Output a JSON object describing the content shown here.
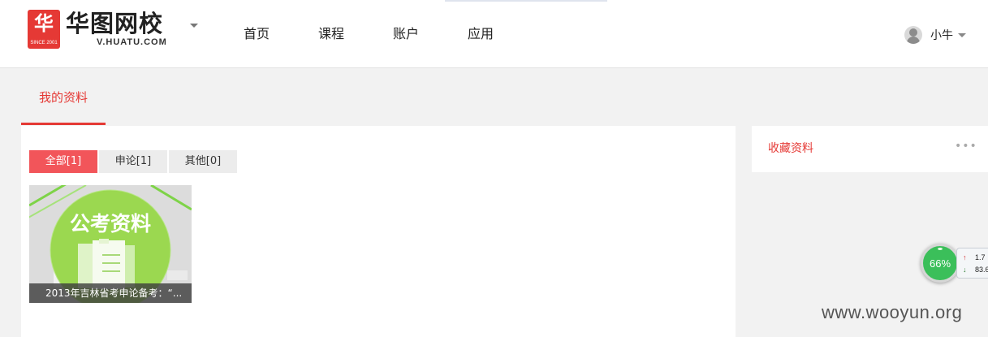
{
  "header": {
    "logo_glyph": "华",
    "logo_since": "SINCE 2001",
    "logo_name": "华图网校",
    "logo_domain": "V.HUATU.COM",
    "nav": [
      "首页",
      "课程",
      "账户",
      "应用"
    ],
    "user_name": "小牛"
  },
  "section": {
    "title": "我的资料"
  },
  "filters": [
    {
      "label": "全部[1]",
      "active": true
    },
    {
      "label": "申论[1]",
      "active": false
    },
    {
      "label": "其他[0]",
      "active": false
    }
  ],
  "documents": [
    {
      "cover_text": "公考资料",
      "caption": "2013年吉林省考申论备考：“..."
    }
  ],
  "sidebar": {
    "title": "收藏资料",
    "more": "•••"
  },
  "speed_widget": {
    "percent": "66%",
    "upload": "1.7",
    "download": "83.6"
  },
  "watermark": "www.wooyun.org",
  "colors": {
    "accent": "#e53935",
    "active_tab": "#f2555a",
    "speed_ball": "#3bbf5a"
  }
}
